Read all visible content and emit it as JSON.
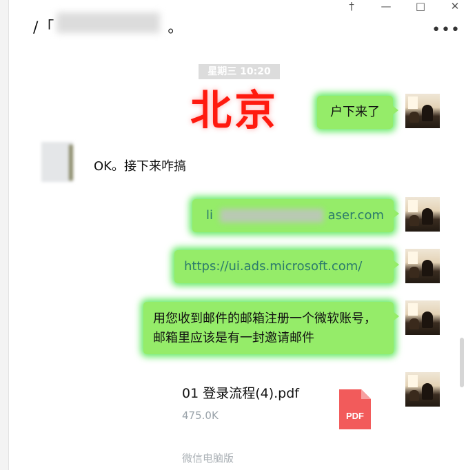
{
  "header": {
    "title_prefix": "/「",
    "title_suffix": "。",
    "window_controls": [
      "†",
      "—",
      "□",
      "✕"
    ],
    "more_label": "•••"
  },
  "timestamp": "星期三 10:20",
  "sticker_text": "北京",
  "messages": [
    {
      "side": "out",
      "text": "户下来了"
    },
    {
      "side": "in",
      "text": "OK。接下来咋搞"
    },
    {
      "side": "out",
      "text_start": "li",
      "text_end": "aser.com"
    },
    {
      "side": "out",
      "text": "https://ui.ads.microsoft.com/"
    },
    {
      "side": "out",
      "text": "用您收到邮件的邮箱注册一个微软账号，邮箱里应该是有一封邀请邮件"
    }
  ],
  "file": {
    "name": "01 登录流程(4).pdf",
    "size": "475.0K",
    "icon_label": "PDF",
    "icon": "pdf-file-icon"
  },
  "footer": "微信电脑版",
  "colors": {
    "bubble_out": "#95ec69",
    "sticker": "#ff1a0f",
    "pdf": "#f25b5b"
  }
}
